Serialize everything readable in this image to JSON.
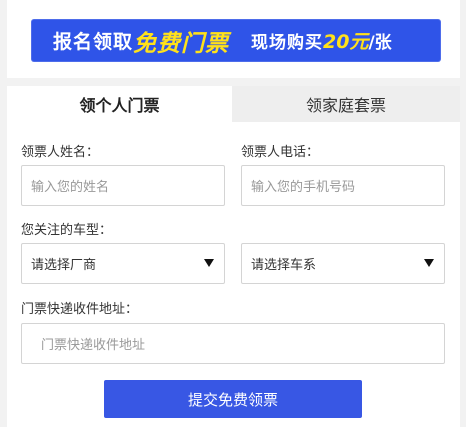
{
  "banner": {
    "part1": "报名领取",
    "part2": "免费门票",
    "part3": "现场购买",
    "part4": "20元",
    "part5": "/张"
  },
  "tabs": [
    {
      "label": "领个人门票"
    },
    {
      "label": "领家庭套票"
    }
  ],
  "form": {
    "name_label": "领票人姓名：",
    "name_placeholder": "输入您的姓名",
    "phone_label": "领票人电话：",
    "phone_placeholder": "输入您的手机号码",
    "car_label": "您关注的车型：",
    "maker_select": "请选择厂商",
    "series_select": "请选择车系",
    "address_label": "门票快递收件地址：",
    "address_placeholder": "门票快递收件地址",
    "submit_label": "提交免费领票"
  }
}
